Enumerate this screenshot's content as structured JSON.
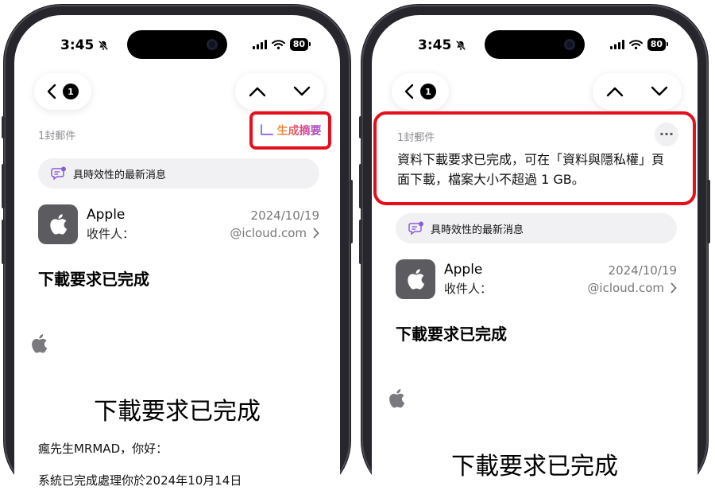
{
  "status_bar": {
    "time": "3:45",
    "battery": "80"
  },
  "nav": {
    "unread_count": "1"
  },
  "mail": {
    "message_count": "1封郵件",
    "summarize_label": "生成摘要",
    "timely_news": "具時效性的最新消息",
    "sender_name": "Apple",
    "recipient_label": "收件人：",
    "recipient_address": "@icloud.com",
    "date": "2024/10/19",
    "subject": "下載要求已完成",
    "body_heading": "下載要求已完成",
    "greeting": "瘋先生MRMAD，你好：",
    "body_line2": "系統已完成處理你於2024年10月14日"
  },
  "summary": {
    "text": "資料下載要求已完成，可在「資料與隱私權」頁面下載，檔案大小不超過 1 GB。"
  },
  "colors": {
    "highlight_red": "#e3101c",
    "gradient_orange": "#f39b2b",
    "gradient_pink": "#e0487a",
    "gradient_purple": "#9d4fe0",
    "frame": "#26262c"
  }
}
